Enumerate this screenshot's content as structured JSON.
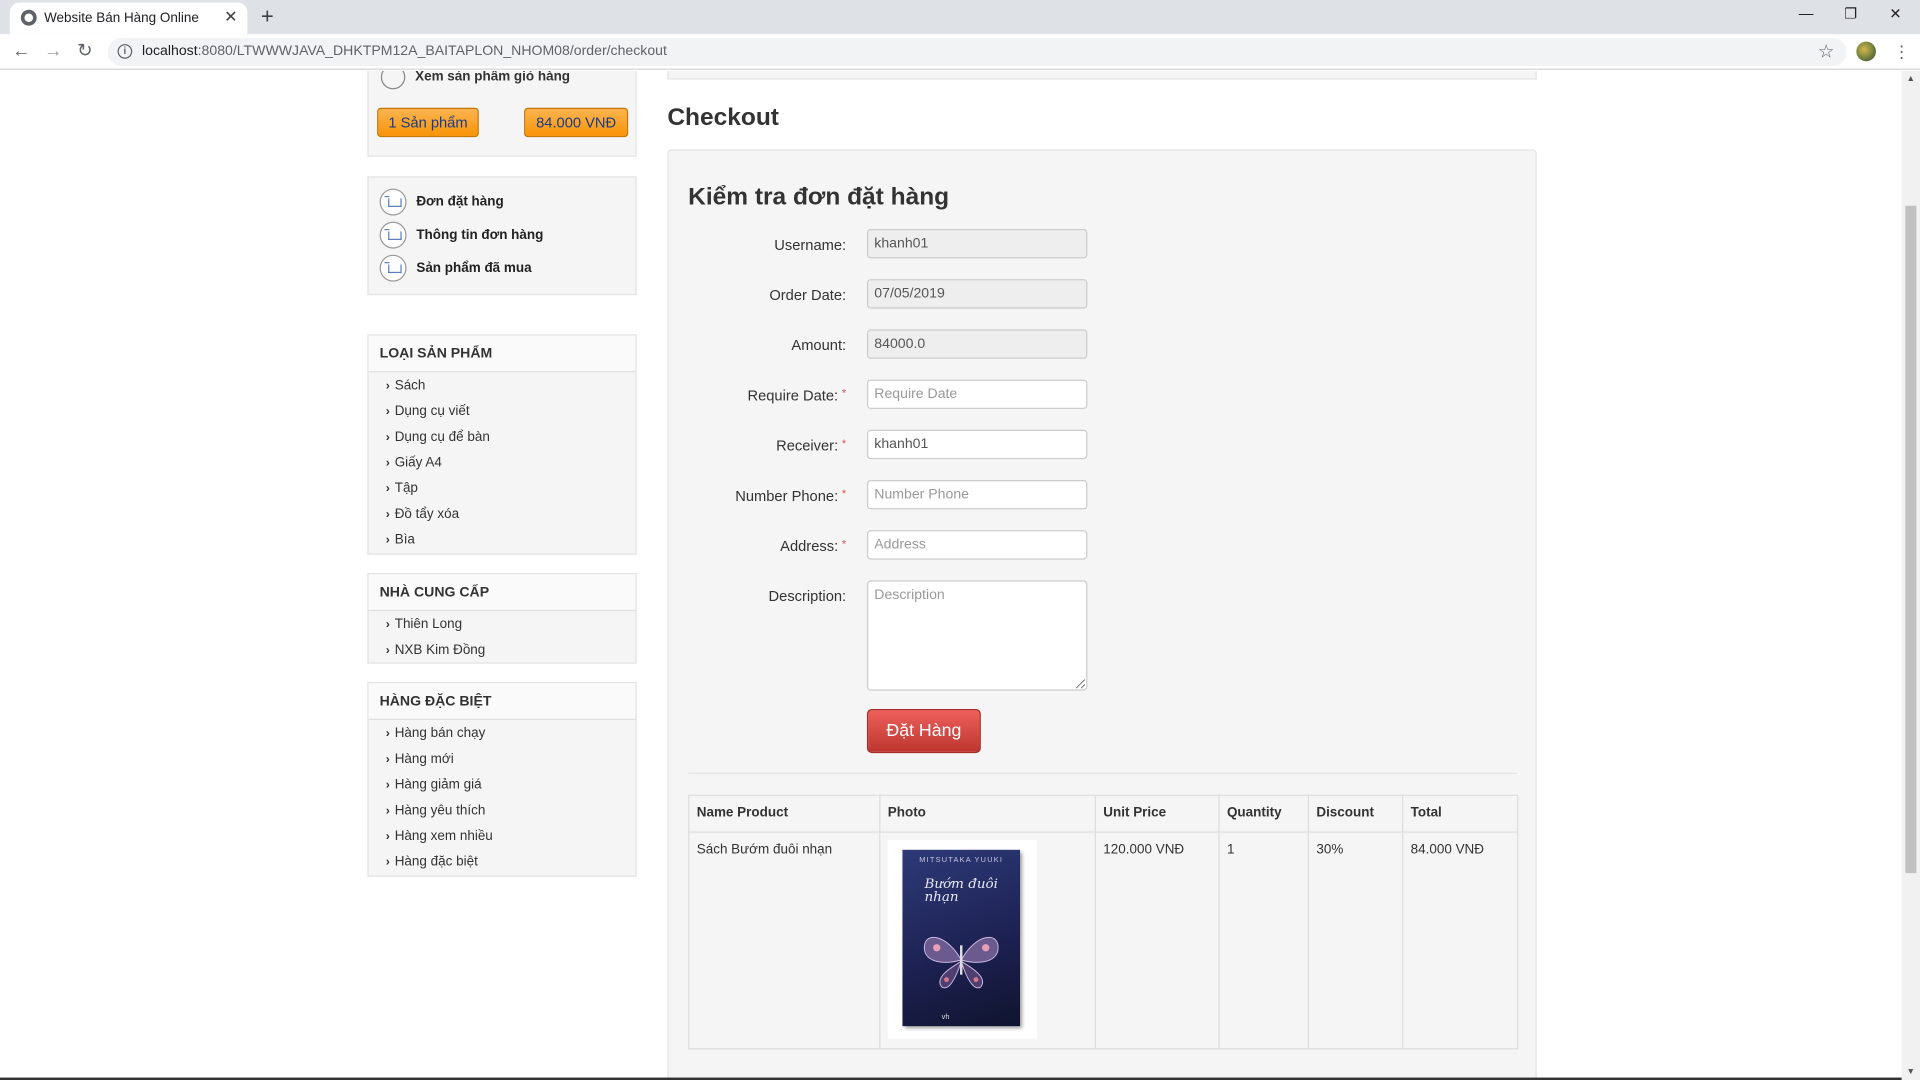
{
  "browser": {
    "tab_title": "Website Bán Hàng Online",
    "tab_close": "✕",
    "new_tab": "+",
    "url_host": "localhost",
    "url_path": ":8080/LTWWWJAVA_DHKTPM12A_BAITAPLON_NHOM08/order/checkout",
    "win_minimize": "—",
    "win_restore": "❐",
    "win_close": "✕"
  },
  "sidebar": {
    "cart_link": "Xem sản phẩm giỏ hàng",
    "cart_count": "1 Sản phẩm",
    "cart_total": "84.000 VNĐ",
    "menu": [
      {
        "label": "Đơn đặt hàng"
      },
      {
        "label": "Thông tin đơn hàng"
      },
      {
        "label": "Sản phẩm đã mua"
      }
    ],
    "categories": {
      "title": "LOẠI SẢN PHẨM",
      "items": [
        "Sách",
        "Dụng cụ viết",
        "Dụng cụ để bàn",
        "Giấy A4",
        "Tập",
        "Đồ tẩy xóa",
        "Bìa"
      ]
    },
    "suppliers": {
      "title": "NHÀ CUNG CẤP",
      "items": [
        "Thiên Long",
        "NXB Kim Đồng"
      ]
    },
    "special": {
      "title": "HÀNG ĐẶC BIỆT",
      "items": [
        "Hàng bán chạy",
        "Hàng mới",
        "Hàng giảm giá",
        "Hàng yêu thích",
        "Hàng xem nhiều",
        "Hàng đặc biệt"
      ]
    }
  },
  "main": {
    "page_title": "Checkout",
    "form_title": "Kiểm tra đơn đặt hàng",
    "fields": {
      "username": {
        "label": "Username:",
        "value": "khanh01"
      },
      "order_date": {
        "label": "Order Date:",
        "value": "07/05/2019"
      },
      "amount": {
        "label": "Amount:",
        "value": "84000.0"
      },
      "require_date": {
        "label": "Require Date:",
        "placeholder": "Require Date",
        "required": "*"
      },
      "receiver": {
        "label": "Receiver:",
        "value": "khanh01",
        "required": "*"
      },
      "phone": {
        "label": "Number Phone:",
        "placeholder": "Number Phone",
        "required": "*"
      },
      "address": {
        "label": "Address:",
        "placeholder": "Address",
        "required": "*"
      },
      "description": {
        "label": "Description:",
        "placeholder": "Description"
      }
    },
    "submit_label": "Đặt Hàng",
    "table": {
      "headers": [
        "Name Product",
        "Photo",
        "Unit Price",
        "Quantity",
        "Discount",
        "Total"
      ],
      "rows": [
        {
          "name": "Sách Bướm đuôi nhạn",
          "photo": {
            "author": "MITSUTAKA YUUKI",
            "title": "Bướm đuôi nhạn",
            "publisher": "vh"
          },
          "unit_price": "120.000 VNĐ",
          "quantity": "1",
          "discount": "30%",
          "total": "84.000 VNĐ"
        }
      ]
    }
  },
  "colors": {
    "orange_button": "#f89406",
    "red_button": "#d9534f",
    "panel_bg": "#f5f5f5"
  }
}
